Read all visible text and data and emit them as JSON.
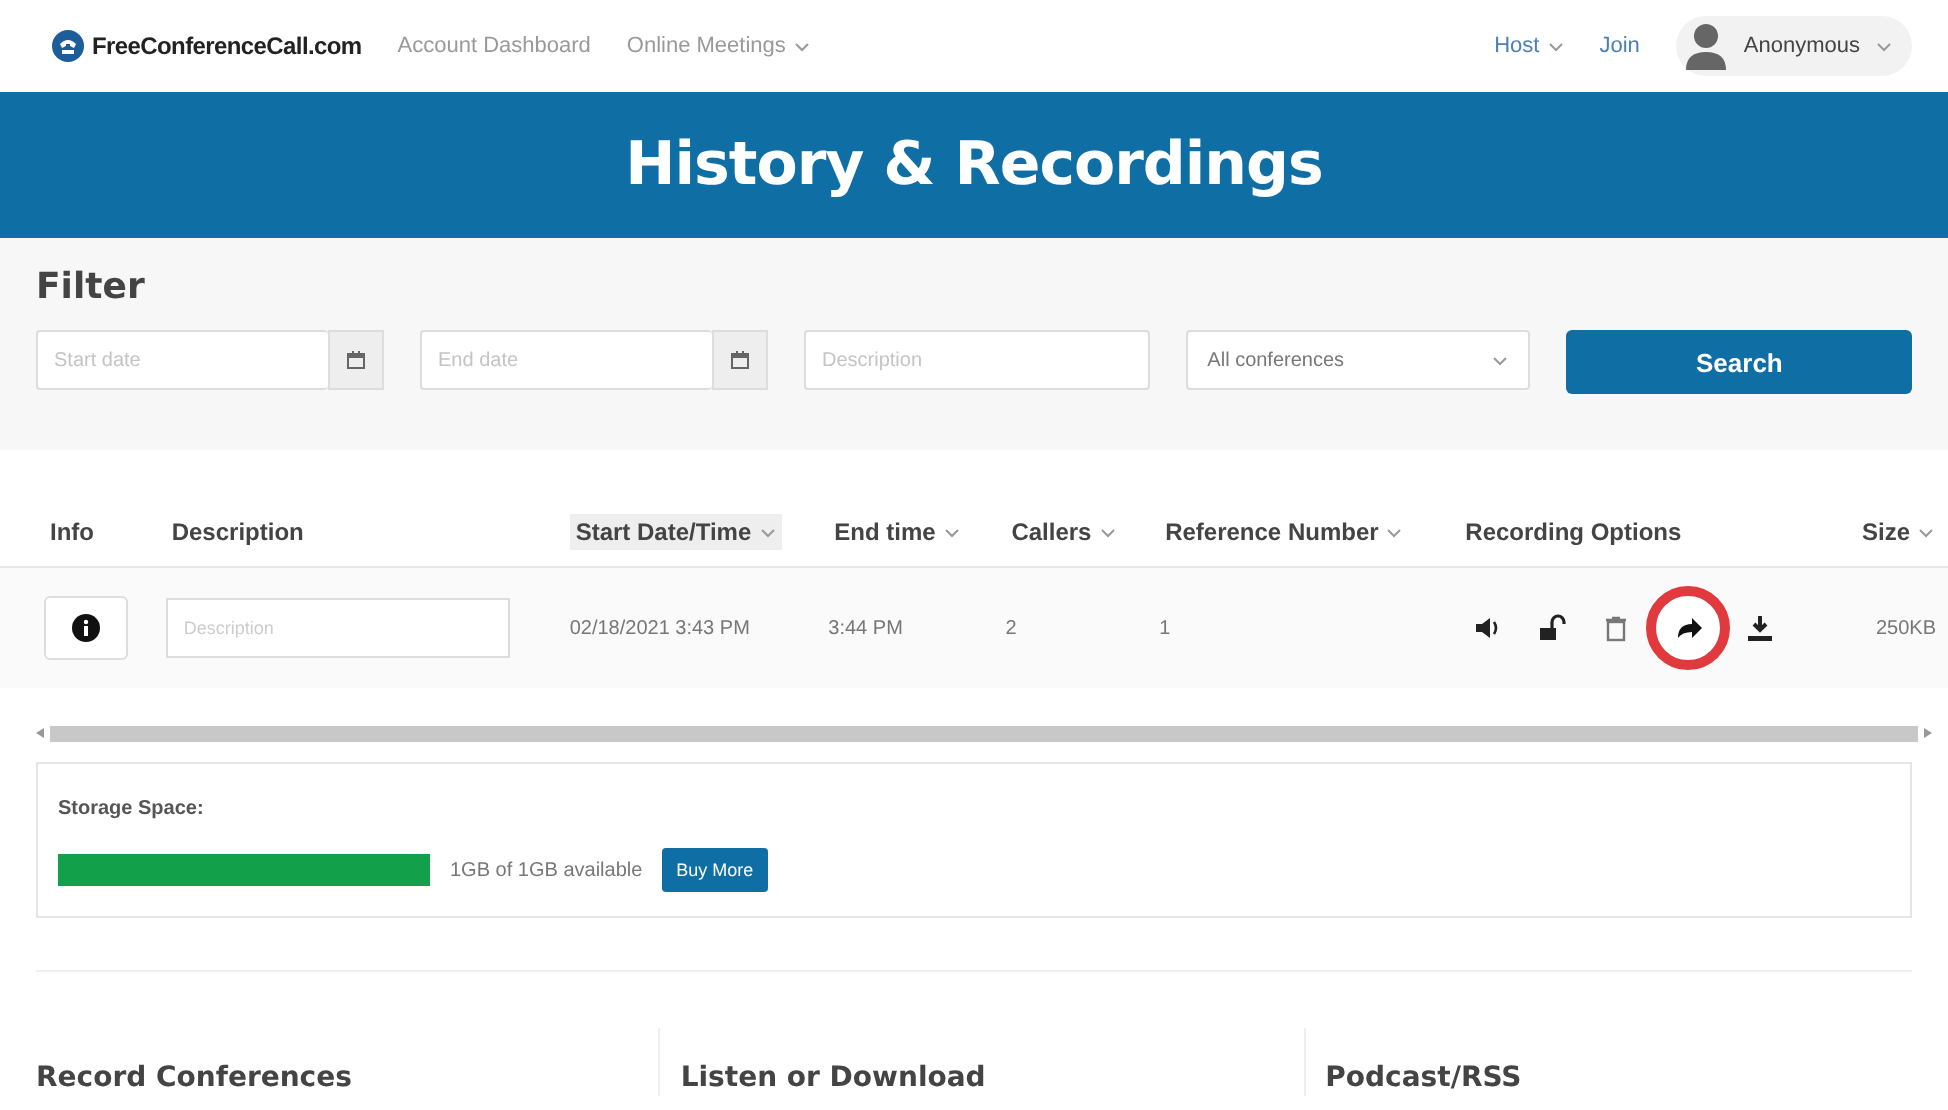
{
  "nav": {
    "brand": "FreeConferenceCall.com",
    "links": [
      {
        "label": "Account Dashboard",
        "dropdown": false
      },
      {
        "label": "Online Meetings",
        "dropdown": true
      }
    ],
    "right": [
      {
        "label": "Host",
        "dropdown": true
      },
      {
        "label": "Join",
        "dropdown": false
      }
    ],
    "user": "Anonymous"
  },
  "banner": {
    "title": "History & Recordings"
  },
  "filter": {
    "title": "Filter",
    "fields": [
      {
        "kind": "date",
        "placeholder": "Start date"
      },
      {
        "kind": "date",
        "placeholder": "End date"
      },
      {
        "kind": "text",
        "placeholder": "Description"
      },
      {
        "kind": "select",
        "value": "All conferences"
      }
    ],
    "button": "Search"
  },
  "table": {
    "columns": [
      {
        "label": "Info",
        "sortable": false,
        "selected": false
      },
      {
        "label": "Description",
        "sortable": false,
        "selected": false
      },
      {
        "label": "Start Date/Time",
        "sortable": true,
        "selected": true
      },
      {
        "label": "End time",
        "sortable": true,
        "selected": false
      },
      {
        "label": "Callers",
        "sortable": true,
        "selected": false
      },
      {
        "label": "Reference Number",
        "sortable": true,
        "selected": false
      },
      {
        "label": "Recording Options",
        "sortable": false,
        "selected": false
      },
      {
        "label": "Size",
        "sortable": true,
        "selected": false
      }
    ],
    "rows": [
      {
        "description_placeholder": "Description",
        "start": "02/18/2021 3:43 PM",
        "end": "3:44 PM",
        "callers": "2",
        "reference": "1",
        "options": [
          {
            "kind": "play",
            "highlighted": false
          },
          {
            "kind": "lock",
            "highlighted": false
          },
          {
            "kind": "delete",
            "highlighted": false
          },
          {
            "kind": "share",
            "highlighted": true
          },
          {
            "kind": "download",
            "highlighted": false
          }
        ],
        "size": "250KB"
      }
    ]
  },
  "storage": {
    "title": "Storage Space:",
    "level": 1,
    "reading": "1GB of 1GB available",
    "button": "Buy More"
  },
  "footer": [
    {
      "title": "Record Conferences"
    },
    {
      "title": "Listen or Download"
    },
    {
      "title": "Podcast/RSS"
    }
  ]
}
